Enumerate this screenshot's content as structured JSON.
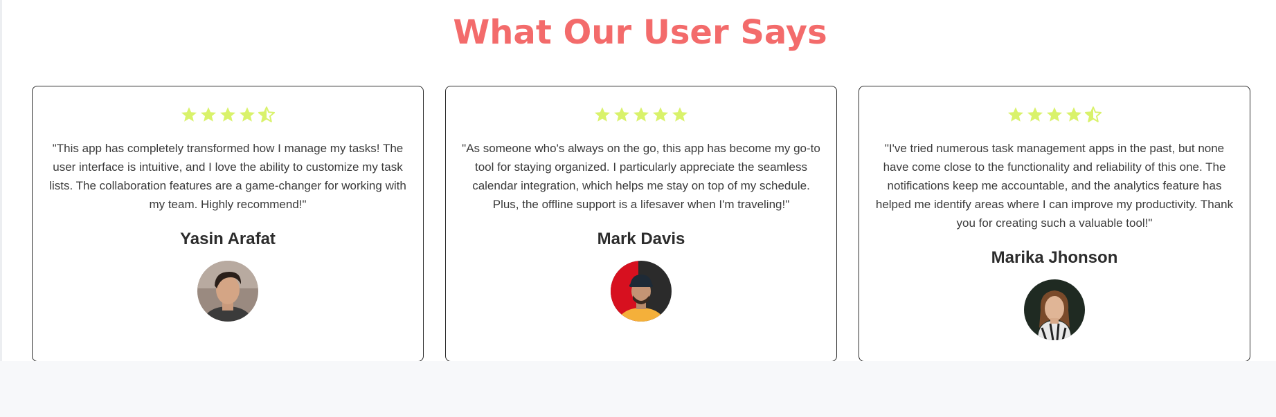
{
  "section": {
    "title": "What Our User Says"
  },
  "colors": {
    "title": "#f36b6b",
    "star": "#d9f26b",
    "card_border": "#2b2b2b"
  },
  "testimonials": [
    {
      "rating": 4.5,
      "quote": "\"This app has completely transformed how I manage my tasks! The user interface is intuitive, and I love the ability to customize my task lists. The collaboration features are a game-changer for working with my team. Highly recommend!\"",
      "name": "Yasin Arafat",
      "avatar_icon": "avatar-photo"
    },
    {
      "rating": 5,
      "quote": "\"As someone who's always on the go, this app has become my go-to tool for staying organized. I particularly appreciate the seamless calendar integration, which helps me stay on top of my schedule. Plus, the offline support is a lifesaver when I'm traveling!\"",
      "name": "Mark Davis",
      "avatar_icon": "avatar-photo"
    },
    {
      "rating": 4.5,
      "quote": "\"I've tried numerous task management apps in the past, but none have come close to the functionality and reliability of this one. The notifications keep me accountable, and the analytics feature has helped me identify areas where I can improve my productivity. Thank you for creating such a valuable tool!\"",
      "name": "Marika Jhonson",
      "avatar_icon": "avatar-photo"
    }
  ]
}
